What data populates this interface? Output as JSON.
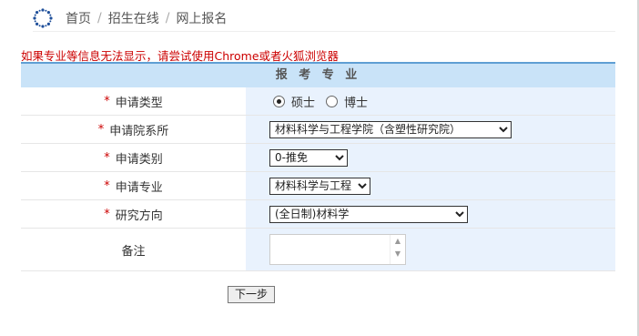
{
  "breadcrumb": {
    "home": "首页",
    "admissions": "招生在线",
    "register": "网上报名"
  },
  "warning": "如果专业等信息无法显示，请尝试使用Chrome或者火狐浏览器",
  "form": {
    "title": "报 考 专 业",
    "required_mark": "*",
    "fields": {
      "apply_type": {
        "label": "申请类型",
        "option_master": "硕士",
        "option_phd": "博士",
        "selected": "硕士"
      },
      "department": {
        "label": "申请院系所",
        "value": "材料科学与工程学院（含塑性研究院）"
      },
      "category": {
        "label": "申请类别",
        "value": "0-推免"
      },
      "major": {
        "label": "申请专业",
        "value": "材料科学与工程"
      },
      "direction": {
        "label": "研究方向",
        "value": "(全日制)材料学"
      },
      "remarks": {
        "label": "备注",
        "value": ""
      }
    }
  },
  "next_button": "下一步"
}
